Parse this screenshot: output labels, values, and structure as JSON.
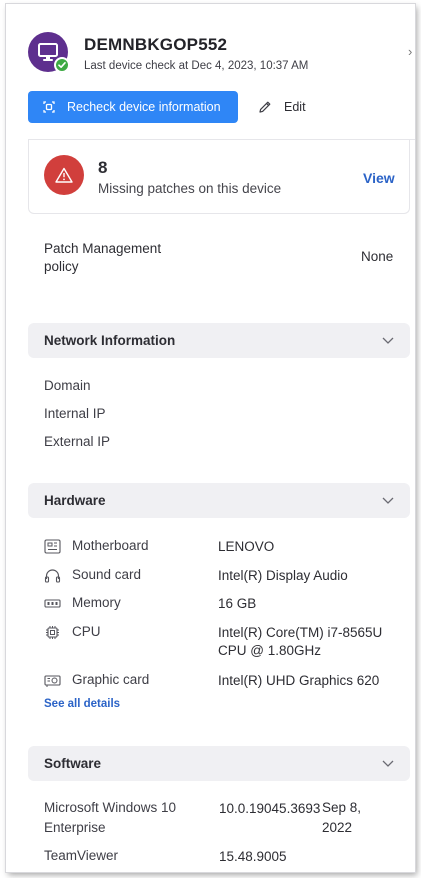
{
  "device": {
    "name": "DEMNBKGOP552",
    "last_check": "Last device check at Dec 4, 2023, 10:37 AM",
    "avatar_color": "#5e2f8e",
    "status_color": "#3daa43"
  },
  "actions": {
    "recheck_label": "Recheck device information",
    "edit_label": "Edit",
    "close_icon": "x-icon"
  },
  "patches": {
    "count": "8",
    "label": "Missing patches on this device",
    "view_label": "View",
    "alert_color": "#d13f3c"
  },
  "policy": {
    "label": "Patch Management policy",
    "value": "None"
  },
  "network": {
    "title": "Network Information",
    "rows": [
      "Domain",
      "Internal IP",
      "External IP"
    ]
  },
  "hardware": {
    "title": "Hardware",
    "rows": [
      {
        "icon": "motherboard-icon",
        "label": "Motherboard",
        "value": "LENOVO"
      },
      {
        "icon": "headphones-icon",
        "label": "Sound card",
        "value": "Intel(R) Display Audio"
      },
      {
        "icon": "memory-icon",
        "label": "Memory",
        "value": "16 GB"
      },
      {
        "icon": "cpu-icon",
        "label": "CPU",
        "value": "Intel(R) Core(TM) i7-8565U CPU @ 1.80GHz"
      },
      {
        "icon": "graphic-card-icon",
        "label": "Graphic card",
        "value": "Intel(R) UHD Graphics 620"
      }
    ],
    "see_all_label": "See all details"
  },
  "software": {
    "title": "Software",
    "rows": [
      {
        "name": "Microsoft Windows 10 Enterprise",
        "version": "10.0.19045.3693",
        "date": "Sep 8, 2022"
      },
      {
        "name": "TeamViewer",
        "version": "15.48.9005",
        "date": ""
      }
    ]
  },
  "theme": {
    "accent": "#2f86f6",
    "link": "#2b63c7"
  }
}
